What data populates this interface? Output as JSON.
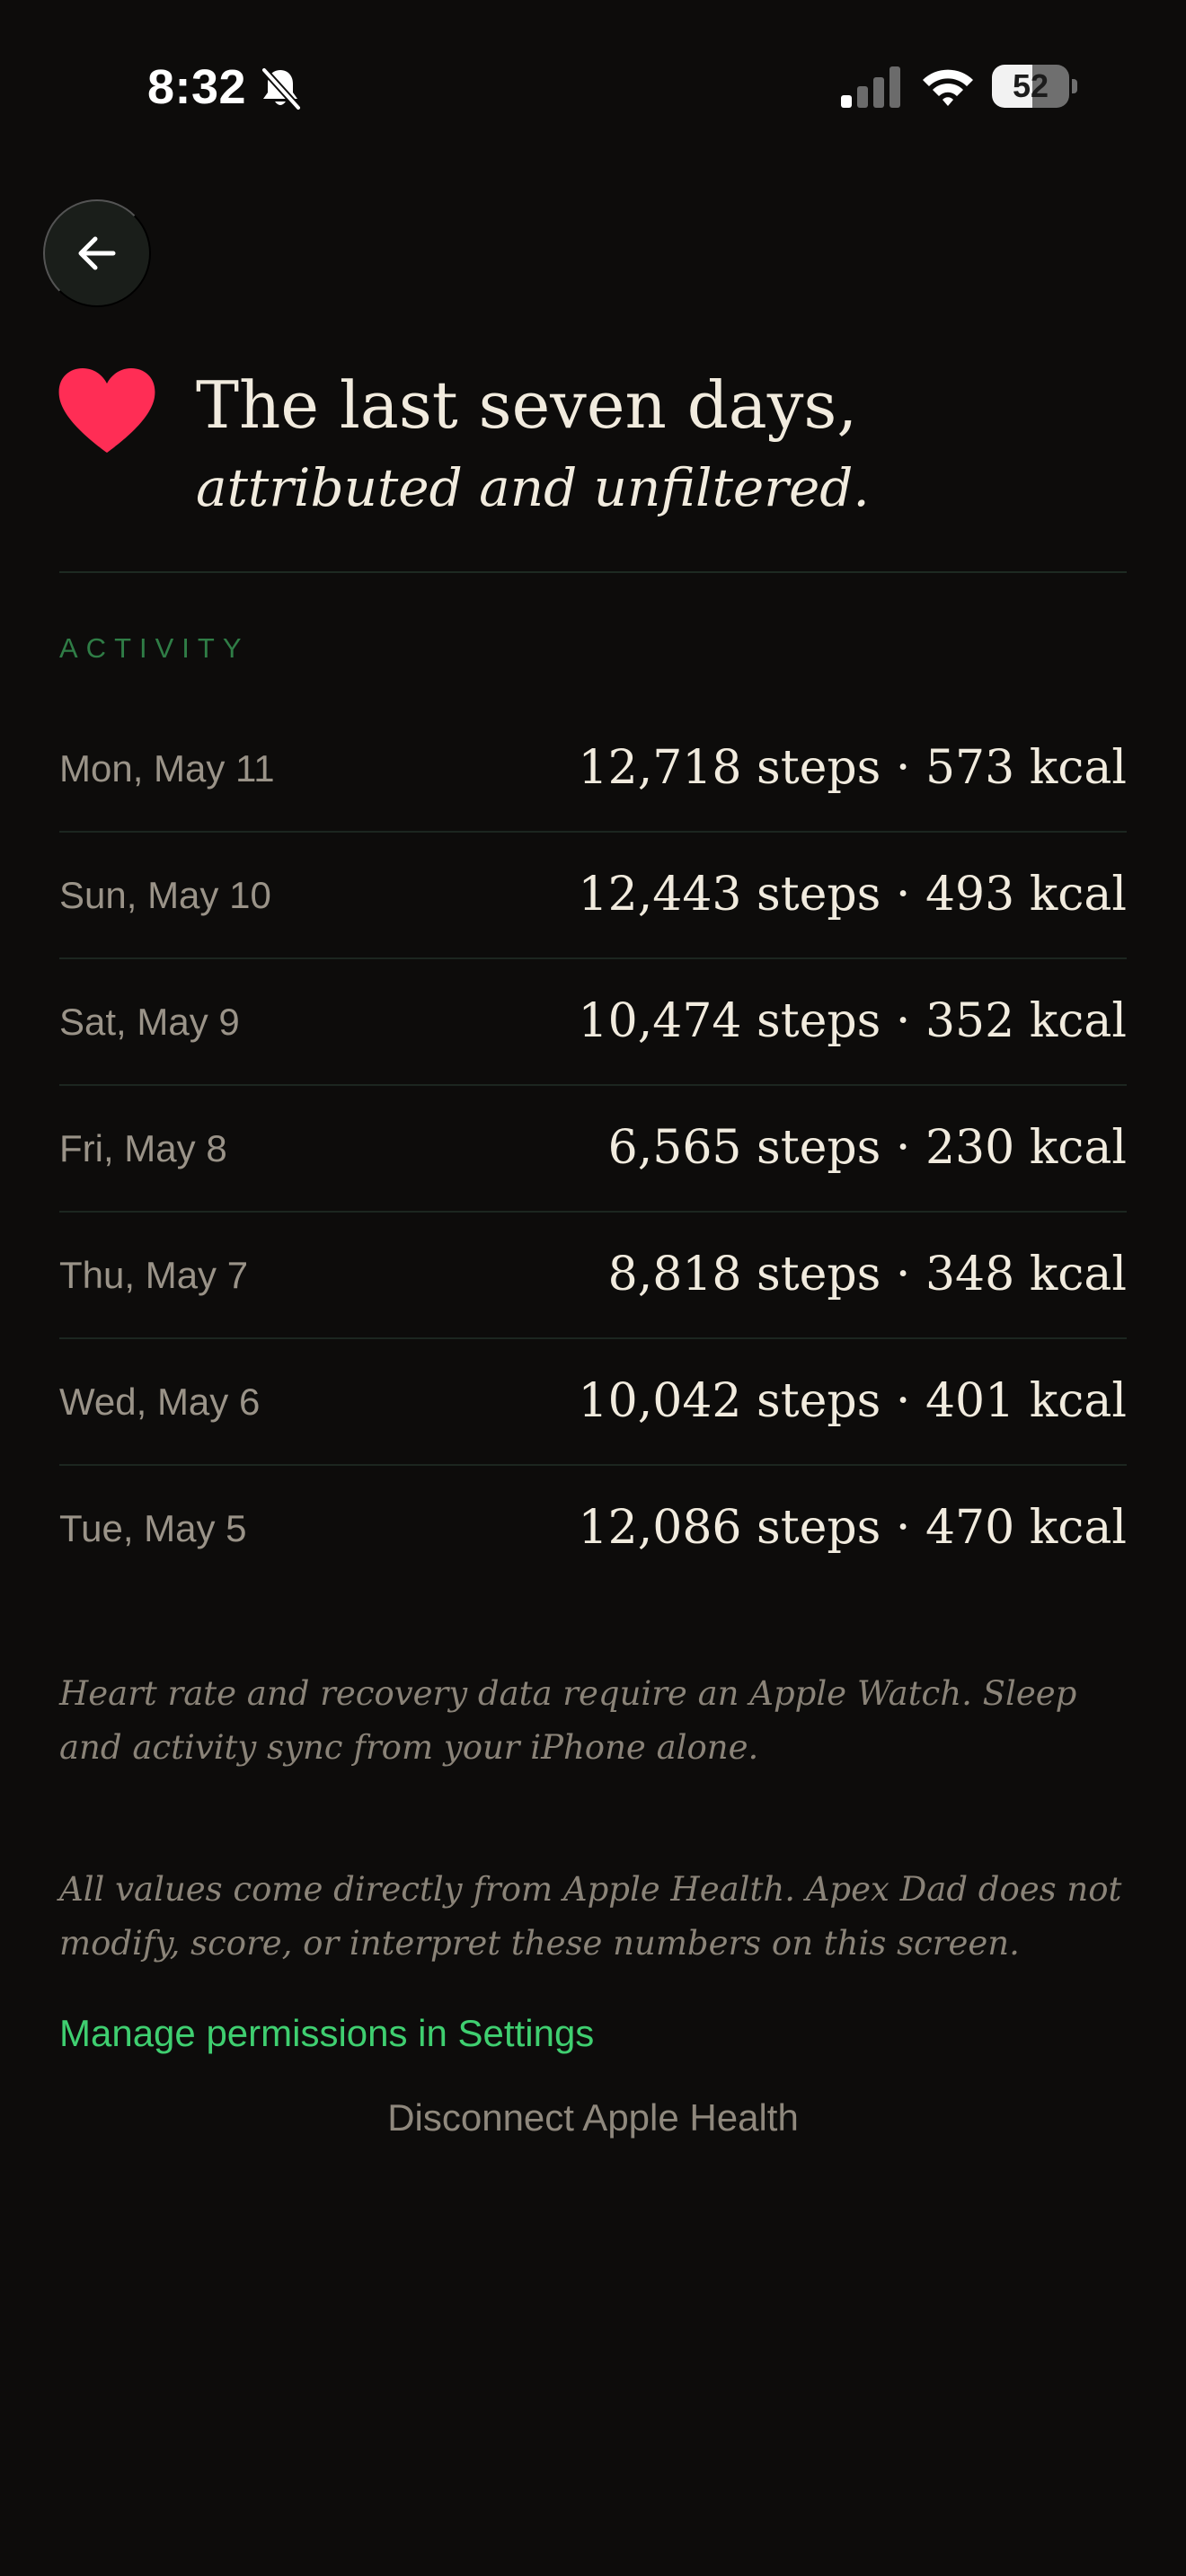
{
  "status_bar": {
    "time": "8:32",
    "battery_level": "52",
    "battery_fraction": 0.52
  },
  "header": {
    "title": "The last seven days,",
    "subtitle": "attributed and unfiltered.",
    "icon": "heart-icon",
    "icon_color": "#ff2d55"
  },
  "activity": {
    "section_label": "ACTIVITY",
    "rows": [
      {
        "date": "Mon, May 11",
        "value": "12,718 steps · 573 kcal"
      },
      {
        "date": "Sun, May 10",
        "value": "12,443 steps · 493 kcal"
      },
      {
        "date": "Sat, May 9",
        "value": "10,474 steps · 352 kcal"
      },
      {
        "date": "Fri, May 8",
        "value": "6,565 steps · 230 kcal"
      },
      {
        "date": "Thu, May 7",
        "value": "8,818 steps · 348 kcal"
      },
      {
        "date": "Wed, May 6",
        "value": "10,042 steps · 401 kcal"
      },
      {
        "date": "Tue, May 5",
        "value": "12,086 steps · 470 kcal"
      }
    ]
  },
  "notes": {
    "watch_note": "Heart rate and recovery data require an Apple Watch. Sleep and activity sync from your iPhone alone.",
    "source_note": "All values come directly from Apple Health. Apex Dad does not modify, score, or interpret these numbers on this screen."
  },
  "actions": {
    "manage_permissions": "Manage permissions in Settings",
    "disconnect": "Disconnect Apple Health"
  },
  "colors": {
    "background": "#0d0c0b",
    "accent_green": "#3fcf70",
    "section_green": "#2f7d46",
    "text_primary": "#f1ebde",
    "text_muted": "#9a9388"
  }
}
